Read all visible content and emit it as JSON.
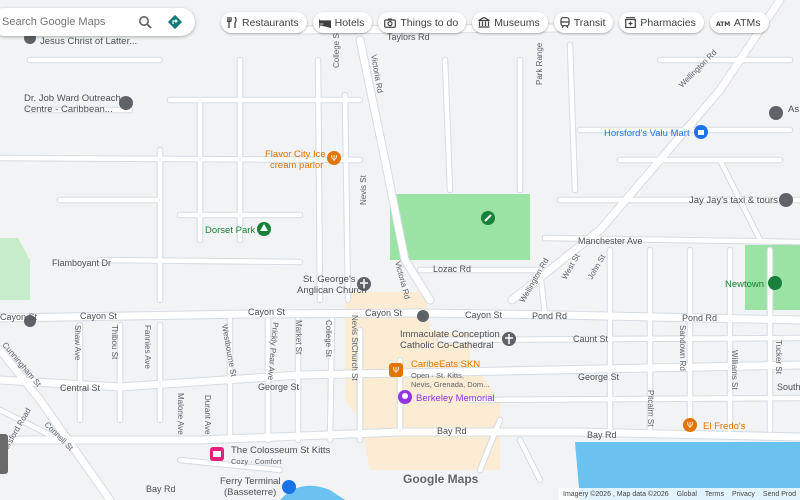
{
  "search": {
    "placeholder": "Search Google Maps"
  },
  "chips": [
    {
      "label": "Restaurants",
      "icon": "fork-knife-icon"
    },
    {
      "label": "Hotels",
      "icon": "bed-icon"
    },
    {
      "label": "Things to do",
      "icon": "camera-icon"
    },
    {
      "label": "Museums",
      "icon": "museum-icon"
    },
    {
      "label": "Transit",
      "icon": "train-icon"
    },
    {
      "label": "Pharmacies",
      "icon": "pharmacy-icon"
    },
    {
      "label": "ATMs",
      "icon": "atm-icon"
    }
  ],
  "streets": {
    "taylors": "Taylors Rd",
    "victoria_top": "Victoria Rd",
    "victoria_bottom": "Victoria Rd",
    "college_top": "College St",
    "college_bottom": "College St",
    "nevis_top": "Nevis St",
    "nevis_bottom": "Nevis St",
    "park_range": "Park Range",
    "wellington_top": "Wellington Rd",
    "wellington_bottom": "Wellington Rd",
    "manchester": "Manchester Ave",
    "lozac": "Lozac Rd",
    "west": "West St",
    "john": "John St",
    "flamboyant": "Flamboyant Dr",
    "cayon_1": "Cayon St",
    "cayon_2": "Cayon St",
    "cayon_3": "Cayon St",
    "cayon_4": "Cayon St",
    "cayon_5": "Cayon St",
    "pond_1": "Pond Rd",
    "pond_2": "Pond Rd",
    "caunt": "Caunt St",
    "shaw": "Shaw Ave",
    "thibou": "Thibou St",
    "fannies": "Fannies Ave",
    "westbourne": "Westbourne St",
    "prickly": "Prickly Pear Ave",
    "market": "Market St",
    "church": "Church St",
    "central": "Central St",
    "malone": "Malone Ave",
    "durant": "Durant Ave",
    "horsford": "Horsford Road",
    "connell": "Connell St",
    "cunningham": "Cunningham St",
    "george_1": "George St",
    "george_2": "George St",
    "sandown": "Sandown Rd",
    "williams": "Williams St",
    "tucker": "Tucker St",
    "pitcairn": "Pitcairn St",
    "south": "South",
    "bay_1": "Bay Rd",
    "bay_2": "Bay Rd",
    "bay_3": "Bay Rd"
  },
  "places": {
    "jesus": "Jesus Christ of Latter...",
    "outreach_line1": "Dr. Job Ward Outreach",
    "outreach_line2": "Centre - Caribbean...",
    "flavor_line1": "Flavor City Ice",
    "flavor_line2": "cream parlor",
    "dorset": "Dorset Park",
    "st_georges_line1": "St. George's",
    "st_georges_line2": "Anglican Church",
    "immaculate_line1": "Immaculate Conception",
    "immaculate_line2": "Catholic Co-Cathedral",
    "caribeats": "CaribeEats SKN",
    "caribeats_sub": "Open · St. Kitts,",
    "caribeats_sub2": "Nevis, Grenada, Dom...",
    "berkeley": "Berkeley Memorial",
    "colosseum": "The Colosseum St Kitts",
    "colosseum_sub": "Cozy · Comfort",
    "ferry_line1": "Ferry Terminal",
    "ferry_line2": "(Basseterre)",
    "horsfords": "Horsford's Valu Mart",
    "jayjays": "Jay Jay's taxi & tours",
    "newtown": "Newtown",
    "elfredos": "El Fredo's",
    "as_partial": "As"
  },
  "branding": {
    "logo": "Google Maps"
  },
  "footer": {
    "imagery": "Imagery ©2026 , Map data ©2026",
    "global": "Global",
    "terms": "Terms",
    "privacy": "Privacy",
    "send": "Send Prod"
  },
  "colors": {
    "land": "#f1f3f4",
    "road": "#ffffff",
    "road_outline": "#d5dce3",
    "park": "#9be3a5",
    "water": "#69c2f0",
    "downtown": "#fbecd3",
    "poi_orange": "#e37400",
    "poi_blue": "#1a73e8",
    "poi_green": "#188038",
    "poi_purple": "#9334e6",
    "poi_pink": "#e3207b"
  }
}
